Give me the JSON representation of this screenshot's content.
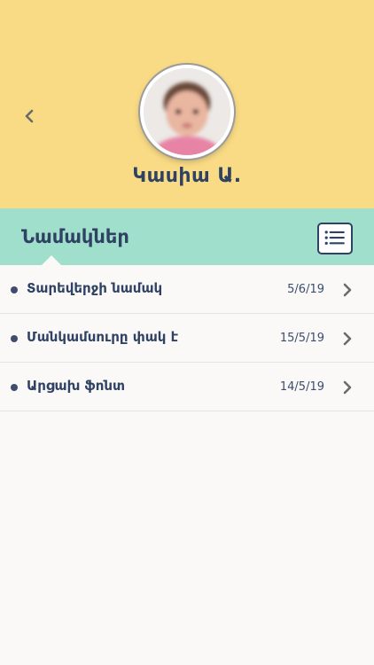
{
  "header": {
    "bg_color": "#fadb85",
    "back_icon": "chevron-left-icon",
    "avatar_alt": "child photo",
    "name": "Կասիա Ա."
  },
  "section": {
    "bg_color": "#a0dfcb",
    "title": "Նամակներ",
    "list_icon": "list-icon"
  },
  "letters": [
    {
      "title": "Տարեվերջի նամակ",
      "date": "5/6/19"
    },
    {
      "title": "Մանկամսուրը փակ է",
      "date": "15/5/19"
    },
    {
      "title": "Արցախ ֆոնտ",
      "date": "14/5/19"
    }
  ],
  "colors": {
    "text_primary": "#2f4263",
    "page_bg": "#faf9f7"
  }
}
